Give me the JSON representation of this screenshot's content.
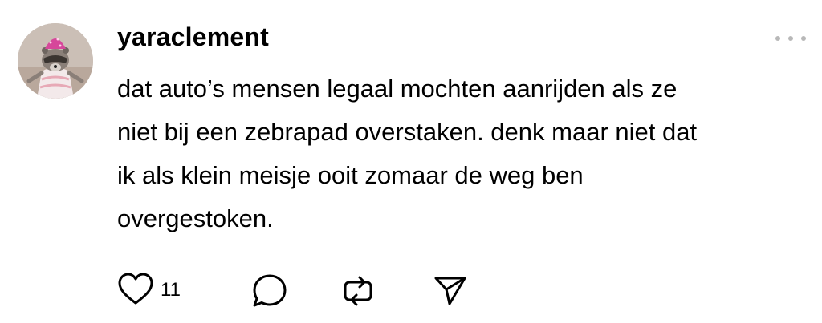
{
  "post": {
    "username": "yaraclement",
    "text": "dat auto’s mensen legaal mochten aanrijden als ze\nniet bij een zebrapad overstaken. denk maar niet dat\nik als klein meisje ooit zomaar de weg ben\novergestoken.",
    "avatar": "avatar-raccoon-tiara",
    "more_icon": "more-dots-icon"
  },
  "actions": {
    "like_count": "11",
    "like_icon": "heart-icon",
    "reply_icon": "comment-bubble-icon",
    "repost_icon": "repost-icon",
    "share_icon": "send-icon"
  },
  "colors": {
    "text": "#000000",
    "icon": "#000000",
    "more_dots": "#b8b8b8",
    "background": "#ffffff"
  }
}
